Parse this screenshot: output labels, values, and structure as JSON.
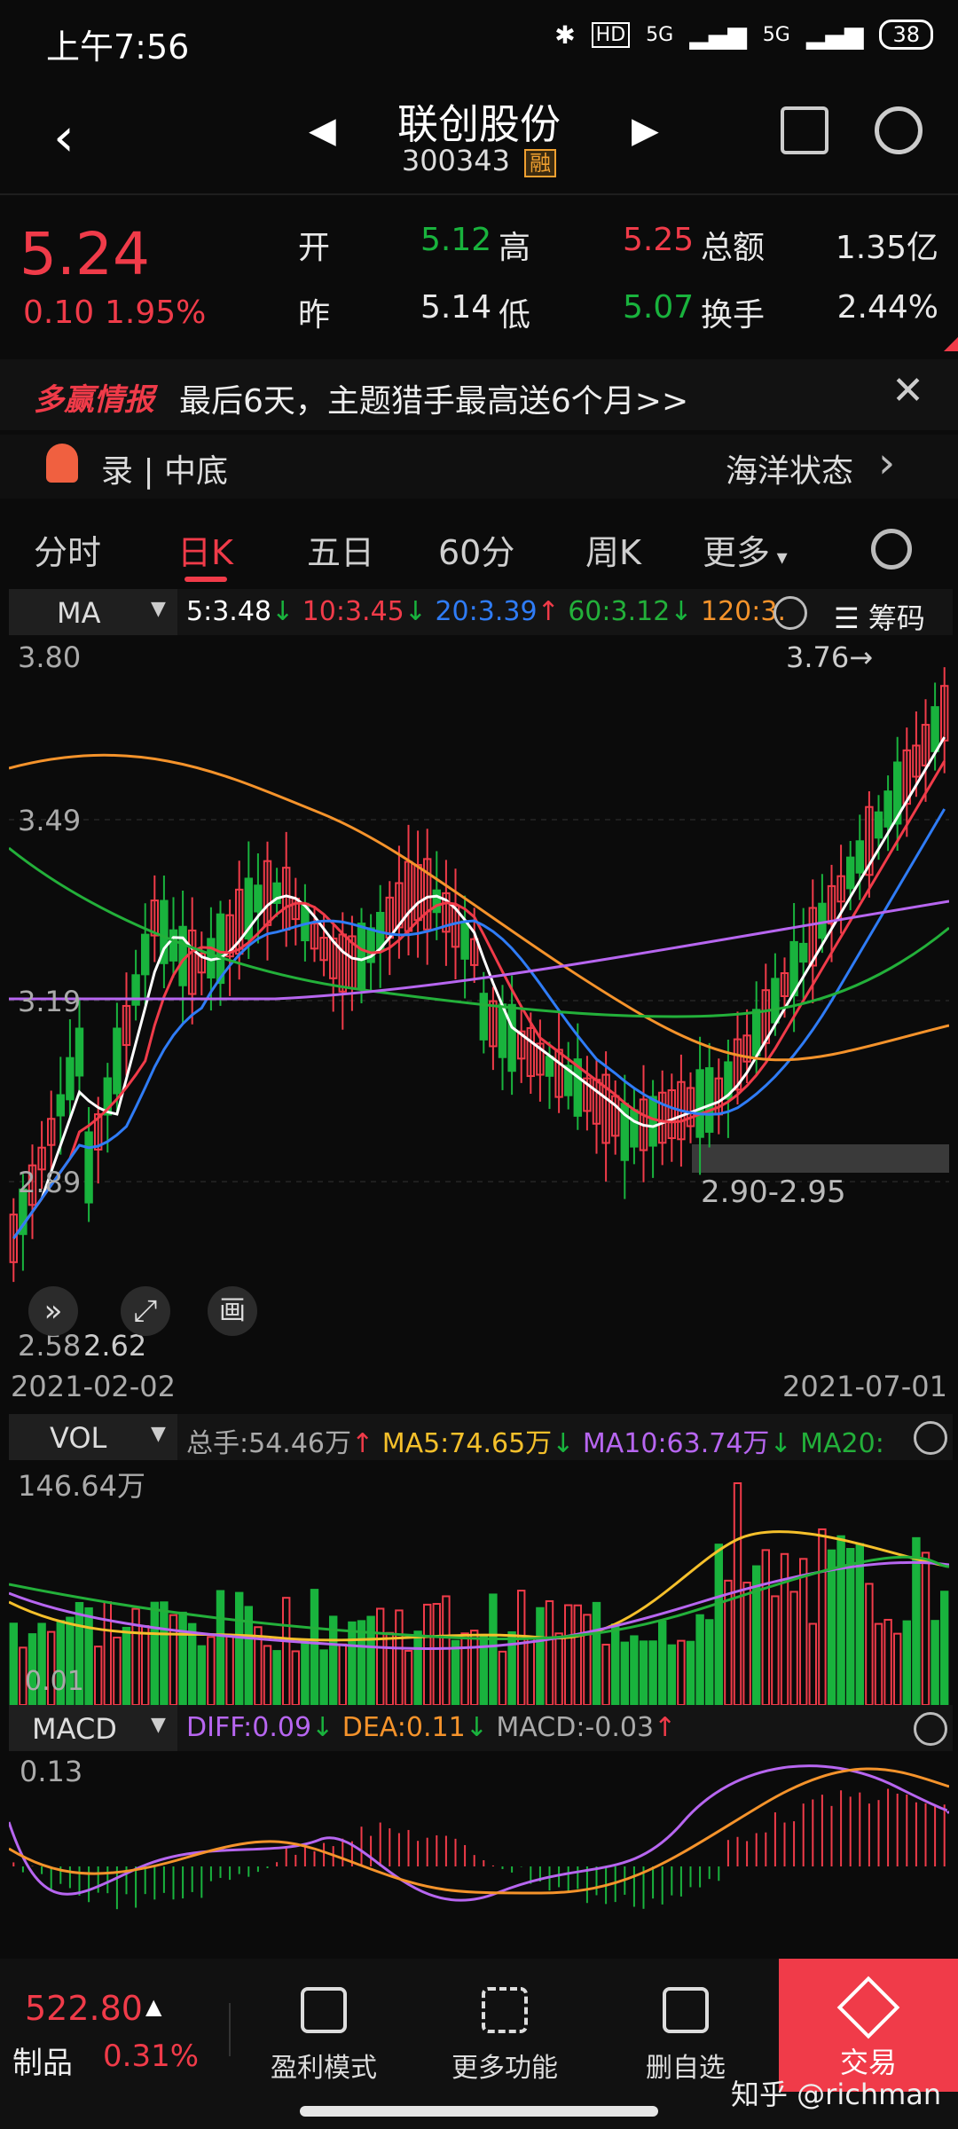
{
  "status_bar": {
    "time": "上午7:56",
    "network1": "5G",
    "network2": "5G",
    "battery": "38",
    "hd": "HD"
  },
  "header": {
    "title": "联创股份",
    "code": "300343",
    "badge": "融"
  },
  "quote": {
    "price": "5.24",
    "change": "0.10",
    "change_pct": "1.95%",
    "open_label": "开",
    "open": "5.12",
    "prev_label": "昨",
    "prev": "5.14",
    "high_label": "高",
    "high": "5.25",
    "low_label": "低",
    "low": "5.07",
    "amount_label": "总额",
    "amount": "1.35亿",
    "turnover_label": "换手",
    "turnover": "2.44%"
  },
  "banner": {
    "brand": "多赢情报",
    "text": "最后6天，主题猎手最高送6个月>>"
  },
  "tags": {
    "left": "录 | 中底",
    "right": "海洋状态"
  },
  "tabs": [
    "分时",
    "日K",
    "五日",
    "60分",
    "周K",
    "更多"
  ],
  "ma_bar": {
    "label": "MA",
    "ma5": "5:3.48",
    "ma10": "10:3.45",
    "ma20": "20:3.39",
    "ma60": "60:3.12",
    "ma120": "120:3.",
    "chips": "筹码"
  },
  "kline": {
    "y_top": "3.80",
    "y_mid": "3.49",
    "y_low1": "3.19",
    "y_low2": "2.89",
    "y_bottom": "2.58",
    "high_marker": "3.76→",
    "low_marker": "2.62",
    "zone_label": "2.90-2.95",
    "date_start": "2021-02-02",
    "date_end": "2021-07-01",
    "ctrl_draw": "画"
  },
  "vol_bar": {
    "label": "VOL",
    "total": "总手:54.46万",
    "ma5": "MA5:74.65万",
    "ma10": "MA10:63.74万",
    "ma20": "MA20:",
    "y_top": "146.64万",
    "y_bottom": "0.01"
  },
  "macd_bar": {
    "label": "MACD",
    "diff": "DIFF:0.09",
    "dea": "DEA:0.11",
    "macd": "MACD:-0.03",
    "y_top": "0.13"
  },
  "bottom_bar": {
    "index_value": "522.80",
    "index_name": "制品",
    "index_pct": "0.31%",
    "btn1": "盈利模式",
    "btn2": "更多功能",
    "btn3": "删自选",
    "btn4": "交易",
    "watermark": "知乎 @richman"
  },
  "colors": {
    "up": "#f03b49",
    "down": "#19b33d",
    "ma5": "#ffffff",
    "ma10": "#f03b49",
    "ma20": "#2f7cf6",
    "ma60": "#23b03a",
    "ma120": "#f5932b",
    "purple": "#b766f0"
  }
}
